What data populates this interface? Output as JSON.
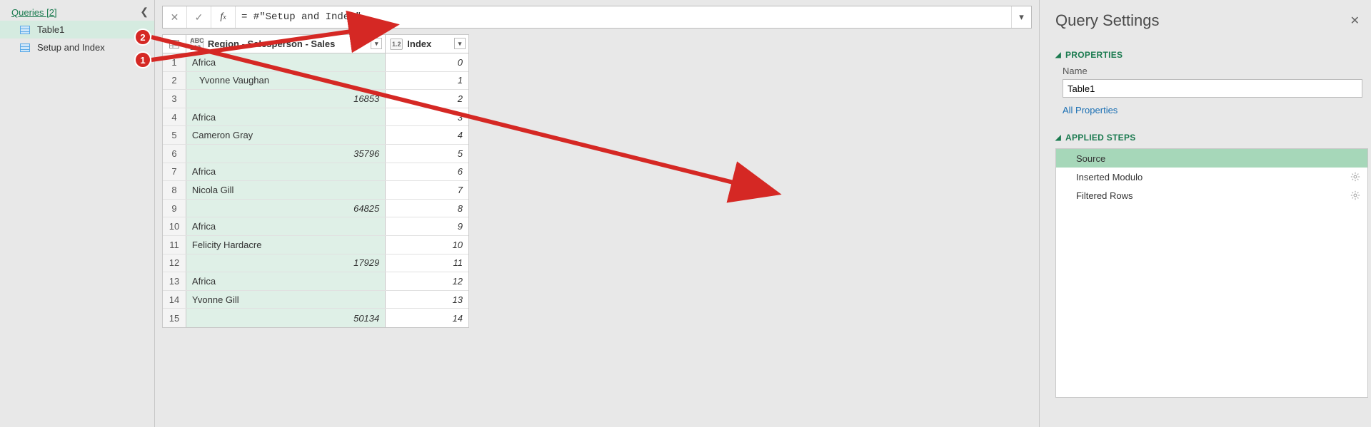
{
  "queries": {
    "header": "Queries [2]",
    "items": [
      {
        "label": "Table1",
        "active": true
      },
      {
        "label": "Setup and Index",
        "active": false
      }
    ]
  },
  "formula_bar": {
    "value": "= #\"Setup and Index\""
  },
  "table": {
    "col1_type": "ABC 123",
    "col1_label": "Region - Salesperson - Sales",
    "col2_type": "1.2",
    "col2_label": "Index",
    "rows": [
      {
        "n": "1",
        "c1": "Africa",
        "style": "",
        "c2": "0"
      },
      {
        "n": "2",
        "c1": "Yvonne Vaughan",
        "style": "pad",
        "c2": "1"
      },
      {
        "n": "3",
        "c1": "16853",
        "style": "num",
        "c2": "2"
      },
      {
        "n": "4",
        "c1": "Africa",
        "style": "",
        "c2": "3"
      },
      {
        "n": "5",
        "c1": "Cameron Gray",
        "style": "",
        "c2": "4"
      },
      {
        "n": "6",
        "c1": "35796",
        "style": "num",
        "c2": "5"
      },
      {
        "n": "7",
        "c1": "Africa",
        "style": "",
        "c2": "6"
      },
      {
        "n": "8",
        "c1": "Nicola Gill",
        "style": "",
        "c2": "7"
      },
      {
        "n": "9",
        "c1": "64825",
        "style": "num",
        "c2": "8"
      },
      {
        "n": "10",
        "c1": "Africa",
        "style": "",
        "c2": "9"
      },
      {
        "n": "11",
        "c1": "Felicity Hardacre",
        "style": "",
        "c2": "10"
      },
      {
        "n": "12",
        "c1": "17929",
        "style": "num",
        "c2": "11"
      },
      {
        "n": "13",
        "c1": "Africa",
        "style": "",
        "c2": "12"
      },
      {
        "n": "14",
        "c1": "Yvonne Gill",
        "style": "",
        "c2": "13"
      },
      {
        "n": "15",
        "c1": "50134",
        "style": "num",
        "c2": "14"
      }
    ]
  },
  "settings": {
    "title": "Query Settings",
    "properties_header": "PROPERTIES",
    "name_label": "Name",
    "name_value": "Table1",
    "all_properties": "All Properties",
    "steps_header": "APPLIED STEPS",
    "steps": [
      {
        "label": "Source",
        "gear": false,
        "active": true
      },
      {
        "label": "Inserted Modulo",
        "gear": true,
        "active": false
      },
      {
        "label": "Filtered Rows",
        "gear": true,
        "active": false
      }
    ]
  },
  "callouts": {
    "b1": "1",
    "b2": "2"
  }
}
